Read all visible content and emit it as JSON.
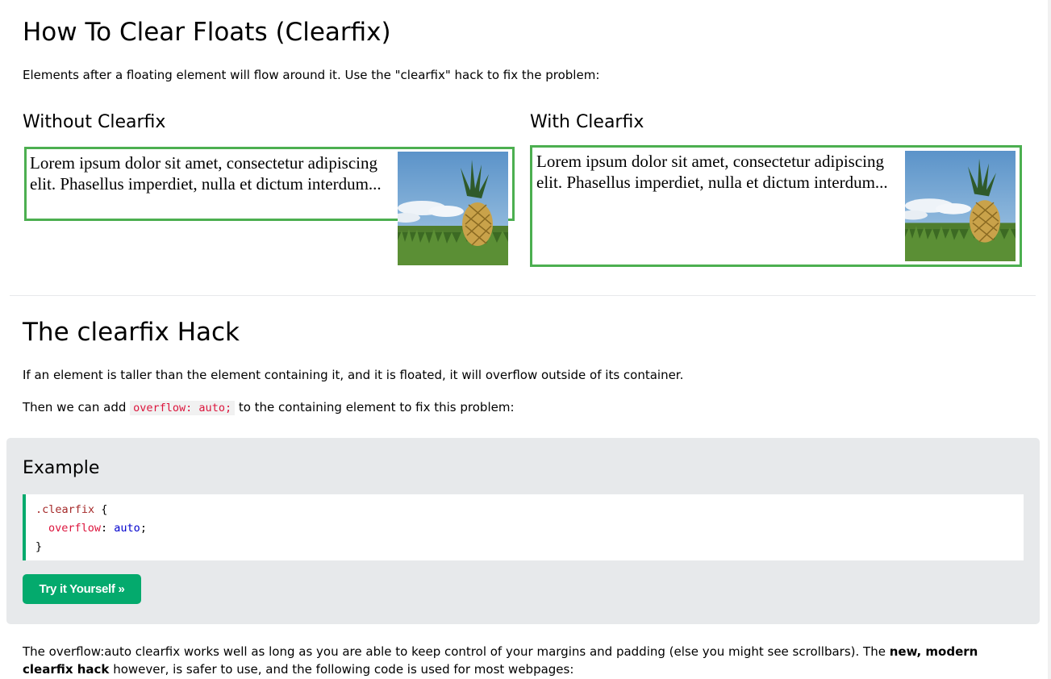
{
  "page": {
    "title": "How To Clear Floats (Clearfix)",
    "intro": "Elements after a floating element will flow around it. Use the \"clearfix\" hack to fix the problem:"
  },
  "demo": {
    "without_title": "Without Clearfix",
    "with_title": "With Clearfix",
    "lorem": "Lorem ipsum dolor sit amet, consectetur adipiscing elit. Phasellus imperdiet, nulla et dictum interdum...",
    "image": "pineapple-image",
    "border_color": "#4CAF50"
  },
  "hack": {
    "title": "The clearfix Hack",
    "p1": "If an element is taller than the element containing it, and it is floated, it will overflow outside of its container.",
    "p2_before": "Then we can add ",
    "p2_code": "overflow: auto;",
    "p2_after": " to the containing element to fix this problem:"
  },
  "example": {
    "title": "Example",
    "code_selector": ".clearfix",
    "code_open": " {",
    "code_prop": "overflow",
    "code_colon": ": ",
    "code_value": "auto",
    "code_semi": ";",
    "code_close": "}",
    "button_label": "Try it Yourself »",
    "accent": "#04AA6D"
  },
  "footer_text": {
    "part1": "The overflow:auto clearfix works well as long as you are able to keep control of your margins and padding (else you might see scrollbars). The ",
    "bold": "new, modern clearfix hack",
    "part2": " however, is safer to use, and the following code is used for most webpages:"
  }
}
